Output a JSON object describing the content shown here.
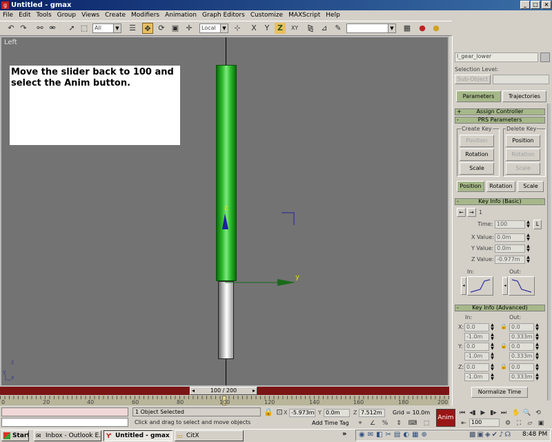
{
  "window": {
    "title": "Untitled - gmax"
  },
  "menu": [
    "File",
    "Edit",
    "Tools",
    "Group",
    "Views",
    "Create",
    "Modifiers",
    "Animation",
    "Graph Editors",
    "Customize",
    "MAXScript",
    "Help"
  ],
  "toolbar": {
    "filter": "All",
    "coord": "Local",
    "axis_x": "X",
    "axis_y": "Y",
    "axis_z": "Z",
    "axis_xy": "XY"
  },
  "viewport": {
    "label": "Left",
    "note": "Move the slider back to 100 and select the Anim button.",
    "axis_y": "y",
    "axis_z": "z",
    "corner_z": "z",
    "corner_y": "y",
    "corner_x": "x"
  },
  "panel": {
    "object_name": "l_gear_lower",
    "selection_level": "Selection Level:",
    "sub_object": "Sub-Object",
    "tab_parameters": "Parameters",
    "tab_trajectories": "Trajectories",
    "assign_controller": "Assign Controller",
    "prs_parameters": "PRS Parameters",
    "create_key": "Create Key",
    "delete_key": "Delete Key",
    "create_position": "Position",
    "create_rotation": "Rotation",
    "create_scale": "Scale",
    "delete_position": "Position",
    "delete_rotation": "Rotation",
    "delete_scale": "Scale",
    "mode_position": "Position",
    "mode_rotation": "Rotation",
    "mode_scale": "Scale",
    "key_info_basic": "Key Info (Basic)",
    "key_number": "1",
    "time_label": "Time:",
    "time_value": "100",
    "lock_label": "L",
    "xvalue_label": "X Value:",
    "xvalue": "0.0m",
    "yvalue_label": "Y Value:",
    "yvalue": "0.0m",
    "zvalue_label": "Z Value:",
    "zvalue": "-0.977m",
    "in_label": "In:",
    "out_label": "Out:",
    "key_info_advanced": "Key Info (Advanced)",
    "adv_in": "In:",
    "adv_out": "Out:",
    "adv_x": "X:",
    "adv_y": "Y:",
    "adv_z": "Z:",
    "adv_in_val": "0.0",
    "adv_in_m": "-1.0m",
    "adv_out_val": "0.0",
    "adv_out_m": "0.333m",
    "normalize_time": "Normalize Time"
  },
  "timeline": {
    "slider": "100 / 200",
    "ticks": [
      "0",
      "20",
      "40",
      "60",
      "80",
      "100",
      "120",
      "140",
      "160",
      "180",
      "200"
    ]
  },
  "status": {
    "selected": "1 Object Selected",
    "prompt": "Click and drag to select and move objects",
    "x_label": "X",
    "x_value": "-5.973m",
    "y_label": "Y",
    "y_value": "0.0m",
    "z_label": "Z",
    "z_value": "7.512m",
    "grid": "Grid = 10.0m",
    "add_time_tag": "Add Time Tag",
    "anim": "Anim",
    "frame": "100"
  },
  "taskbar": {
    "start": "Start",
    "tasks": [
      "Inbox - Outlook E...",
      "Untitled - gmax",
      "CitX"
    ],
    "clock": "8:48 PM"
  }
}
